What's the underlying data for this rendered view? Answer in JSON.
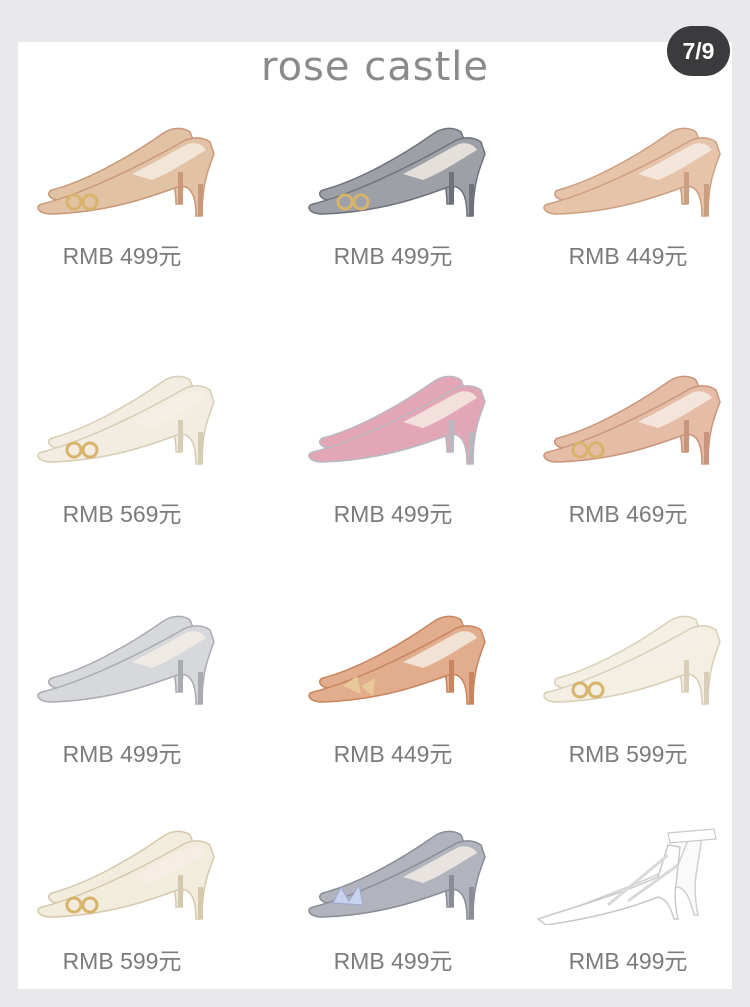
{
  "header": {
    "brand": "rose castle",
    "pager": "7/9"
  },
  "products": [
    {
      "price": "RMB 499元",
      "color": "#e2c2a5",
      "accent": "#c89878",
      "icon": "glitter-pump-icon"
    },
    {
      "price": "RMB 499元",
      "color": "#9ea0a8",
      "accent": "#6f727a",
      "icon": "glitter-pump-icon"
    },
    {
      "price": "RMB 449元",
      "color": "#e6c4aa",
      "accent": "#cc9f80",
      "icon": "dorsay-pump-icon"
    },
    {
      "price": "RMB 569元",
      "color": "#f2ede0",
      "accent": "#d6cdb5",
      "icon": "satin-pump-icon"
    },
    {
      "price": "RMB 499元",
      "color": "#e3a6b6",
      "accent": "#b8b9c0",
      "icon": "gradient-pump-icon"
    },
    {
      "price": "RMB 469元",
      "color": "#e5bca6",
      "accent": "#c9957c",
      "icon": "glitter-pump-icon"
    },
    {
      "price": "RMB 499元",
      "color": "#d7d8dc",
      "accent": "#a9abb1",
      "icon": "silver-pump-icon"
    },
    {
      "price": "RMB 449元",
      "color": "#e1ad8c",
      "accent": "#c8855f",
      "icon": "bow-pump-icon"
    },
    {
      "price": "RMB 599元",
      "color": "#f3efe3",
      "accent": "#d9cfb8",
      "icon": "pearl-pump-icon"
    },
    {
      "price": "RMB 599元",
      "color": "#f2ecdd",
      "accent": "#d5c9ad",
      "icon": "satin-pump-icon"
    },
    {
      "price": "RMB 499元",
      "color": "#b1b4bd",
      "accent": "#8a8d96",
      "icon": "crystal-pump-icon"
    },
    {
      "price": "RMB 499元",
      "color": "#f4f4f5",
      "accent": "#c9c9cc",
      "icon": "strappy-heel-icon"
    }
  ]
}
